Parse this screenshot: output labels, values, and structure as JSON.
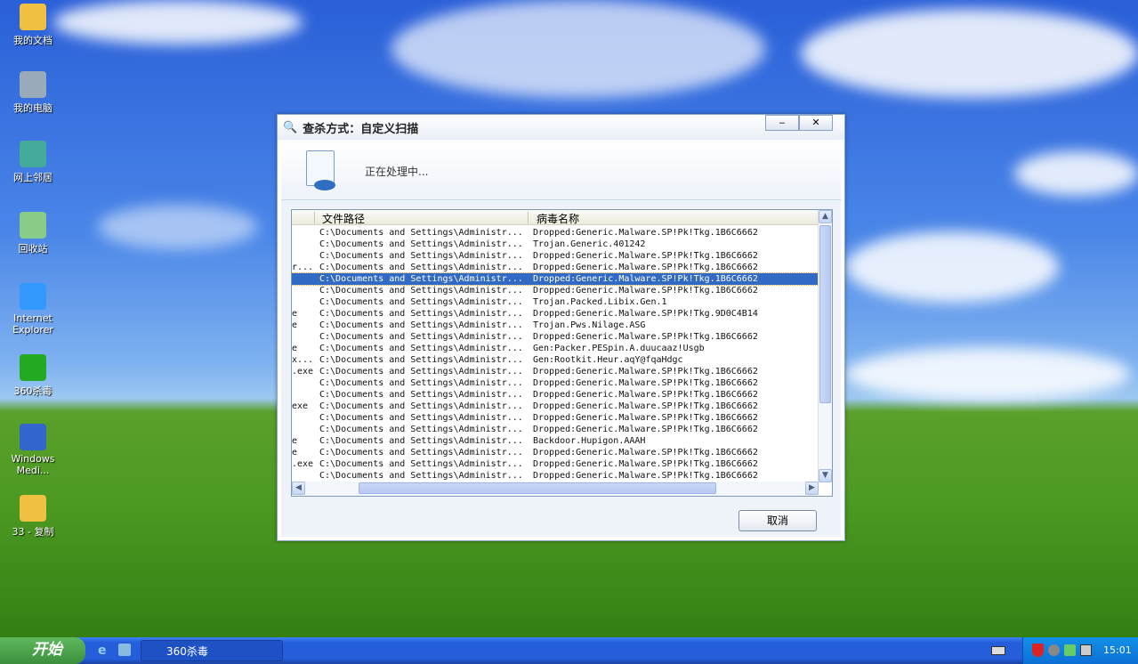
{
  "desktop": {
    "icons": [
      "我的文档",
      "我的电脑",
      "网上邻居",
      "回收站",
      "Internet Explorer",
      "360杀毒",
      "Windows Medi...",
      "33 - 复制"
    ]
  },
  "dialog": {
    "title": "查杀方式：自定义扫描",
    "minimize": "‒",
    "close": "✕",
    "status": "正在处理中...",
    "columns": [
      "文件路径",
      "病毒名称"
    ],
    "rows": [
      {
        "pre": "",
        "path": "C:\\Documents and Settings\\Administr...",
        "virus": "Dropped:Generic.Malware.SP!Pk!Tkg.1B6C6662"
      },
      {
        "pre": "",
        "path": "C:\\Documents and Settings\\Administr...",
        "virus": "Trojan.Generic.401242"
      },
      {
        "pre": "",
        "path": "C:\\Documents and Settings\\Administr...",
        "virus": "Dropped:Generic.Malware.SP!Pk!Tkg.1B6C6662"
      },
      {
        "pre": "r...",
        "path": "C:\\Documents and Settings\\Administr...",
        "virus": "Dropped:Generic.Malware.SP!Pk!Tkg.1B6C6662"
      },
      {
        "pre": "",
        "path": "C:\\Documents and Settings\\Administr...",
        "virus": "Dropped:Generic.Malware.SP!Pk!Tkg.1B6C6662",
        "selected": true
      },
      {
        "pre": "",
        "path": "C:\\Documents and Settings\\Administr...",
        "virus": "Dropped:Generic.Malware.SP!Pk!Tkg.1B6C6662"
      },
      {
        "pre": "",
        "path": "C:\\Documents and Settings\\Administr...",
        "virus": "Trojan.Packed.Libix.Gen.1"
      },
      {
        "pre": "e",
        "path": "C:\\Documents and Settings\\Administr...",
        "virus": "Dropped:Generic.Malware.SP!Pk!Tkg.9D0C4B14"
      },
      {
        "pre": "e",
        "path": "C:\\Documents and Settings\\Administr...",
        "virus": "Trojan.Pws.Nilage.ASG"
      },
      {
        "pre": "",
        "path": "C:\\Documents and Settings\\Administr...",
        "virus": "Dropped:Generic.Malware.SP!Pk!Tkg.1B6C6662"
      },
      {
        "pre": "e",
        "path": "C:\\Documents and Settings\\Administr...",
        "virus": "Gen:Packer.PESpin.A.duucaaz!Usgb"
      },
      {
        "pre": "x...",
        "path": "C:\\Documents and Settings\\Administr...",
        "virus": "Gen:Rootkit.Heur.aqY@fqaHdgc"
      },
      {
        "pre": ".exe",
        "path": "C:\\Documents and Settings\\Administr...",
        "virus": "Dropped:Generic.Malware.SP!Pk!Tkg.1B6C6662"
      },
      {
        "pre": "",
        "path": "C:\\Documents and Settings\\Administr...",
        "virus": "Dropped:Generic.Malware.SP!Pk!Tkg.1B6C6662"
      },
      {
        "pre": "",
        "path": "C:\\Documents and Settings\\Administr...",
        "virus": "Dropped:Generic.Malware.SP!Pk!Tkg.1B6C6662"
      },
      {
        "pre": "exe",
        "path": "C:\\Documents and Settings\\Administr...",
        "virus": "Dropped:Generic.Malware.SP!Pk!Tkg.1B6C6662"
      },
      {
        "pre": "",
        "path": "C:\\Documents and Settings\\Administr...",
        "virus": "Dropped:Generic.Malware.SP!Pk!Tkg.1B6C6662"
      },
      {
        "pre": "",
        "path": "C:\\Documents and Settings\\Administr...",
        "virus": "Dropped:Generic.Malware.SP!Pk!Tkg.1B6C6662"
      },
      {
        "pre": "e",
        "path": "C:\\Documents and Settings\\Administr...",
        "virus": "Backdoor.Hupigon.AAAH"
      },
      {
        "pre": "e",
        "path": "C:\\Documents and Settings\\Administr...",
        "virus": "Dropped:Generic.Malware.SP!Pk!Tkg.1B6C6662"
      },
      {
        "pre": ".exe",
        "path": "C:\\Documents and Settings\\Administr...",
        "virus": "Dropped:Generic.Malware.SP!Pk!Tkg.1B6C6662"
      },
      {
        "pre": "",
        "path": "C:\\Documents and Settings\\Administr...",
        "virus": "Dropped:Generic.Malware.SP!Pk!Tkg.1B6C6662"
      }
    ],
    "cancel": "取消"
  },
  "taskbar": {
    "start": "开始",
    "task": "360杀毒",
    "clock": "15:01"
  }
}
